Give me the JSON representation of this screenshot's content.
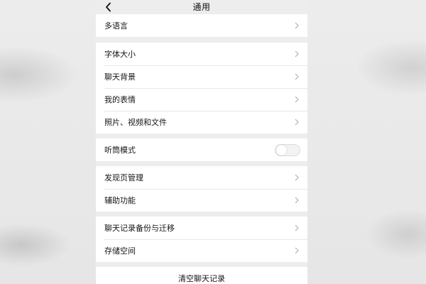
{
  "nav": {
    "title": "通用"
  },
  "groups": [
    {
      "items": [
        {
          "label": "多语言"
        }
      ]
    },
    {
      "items": [
        {
          "label": "字体大小"
        },
        {
          "label": "聊天背景"
        },
        {
          "label": "我的表情"
        },
        {
          "label": "照片、视频和文件"
        }
      ]
    },
    {
      "items": [
        {
          "label": "听筒模式",
          "toggle_on": false
        }
      ]
    },
    {
      "items": [
        {
          "label": "发现页管理"
        },
        {
          "label": "辅助功能"
        }
      ]
    },
    {
      "items": [
        {
          "label": "聊天记录备份与迁移"
        },
        {
          "label": "存储空间"
        }
      ]
    }
  ],
  "clear_button": {
    "label": "清空聊天记录"
  },
  "colors": {
    "background": "#ededed",
    "cell": "#ffffff",
    "chevron": "#b2b2b2",
    "text": "#151515"
  },
  "icons": {
    "back": "chevron-left-icon",
    "row": "chevron-right-icon"
  }
}
